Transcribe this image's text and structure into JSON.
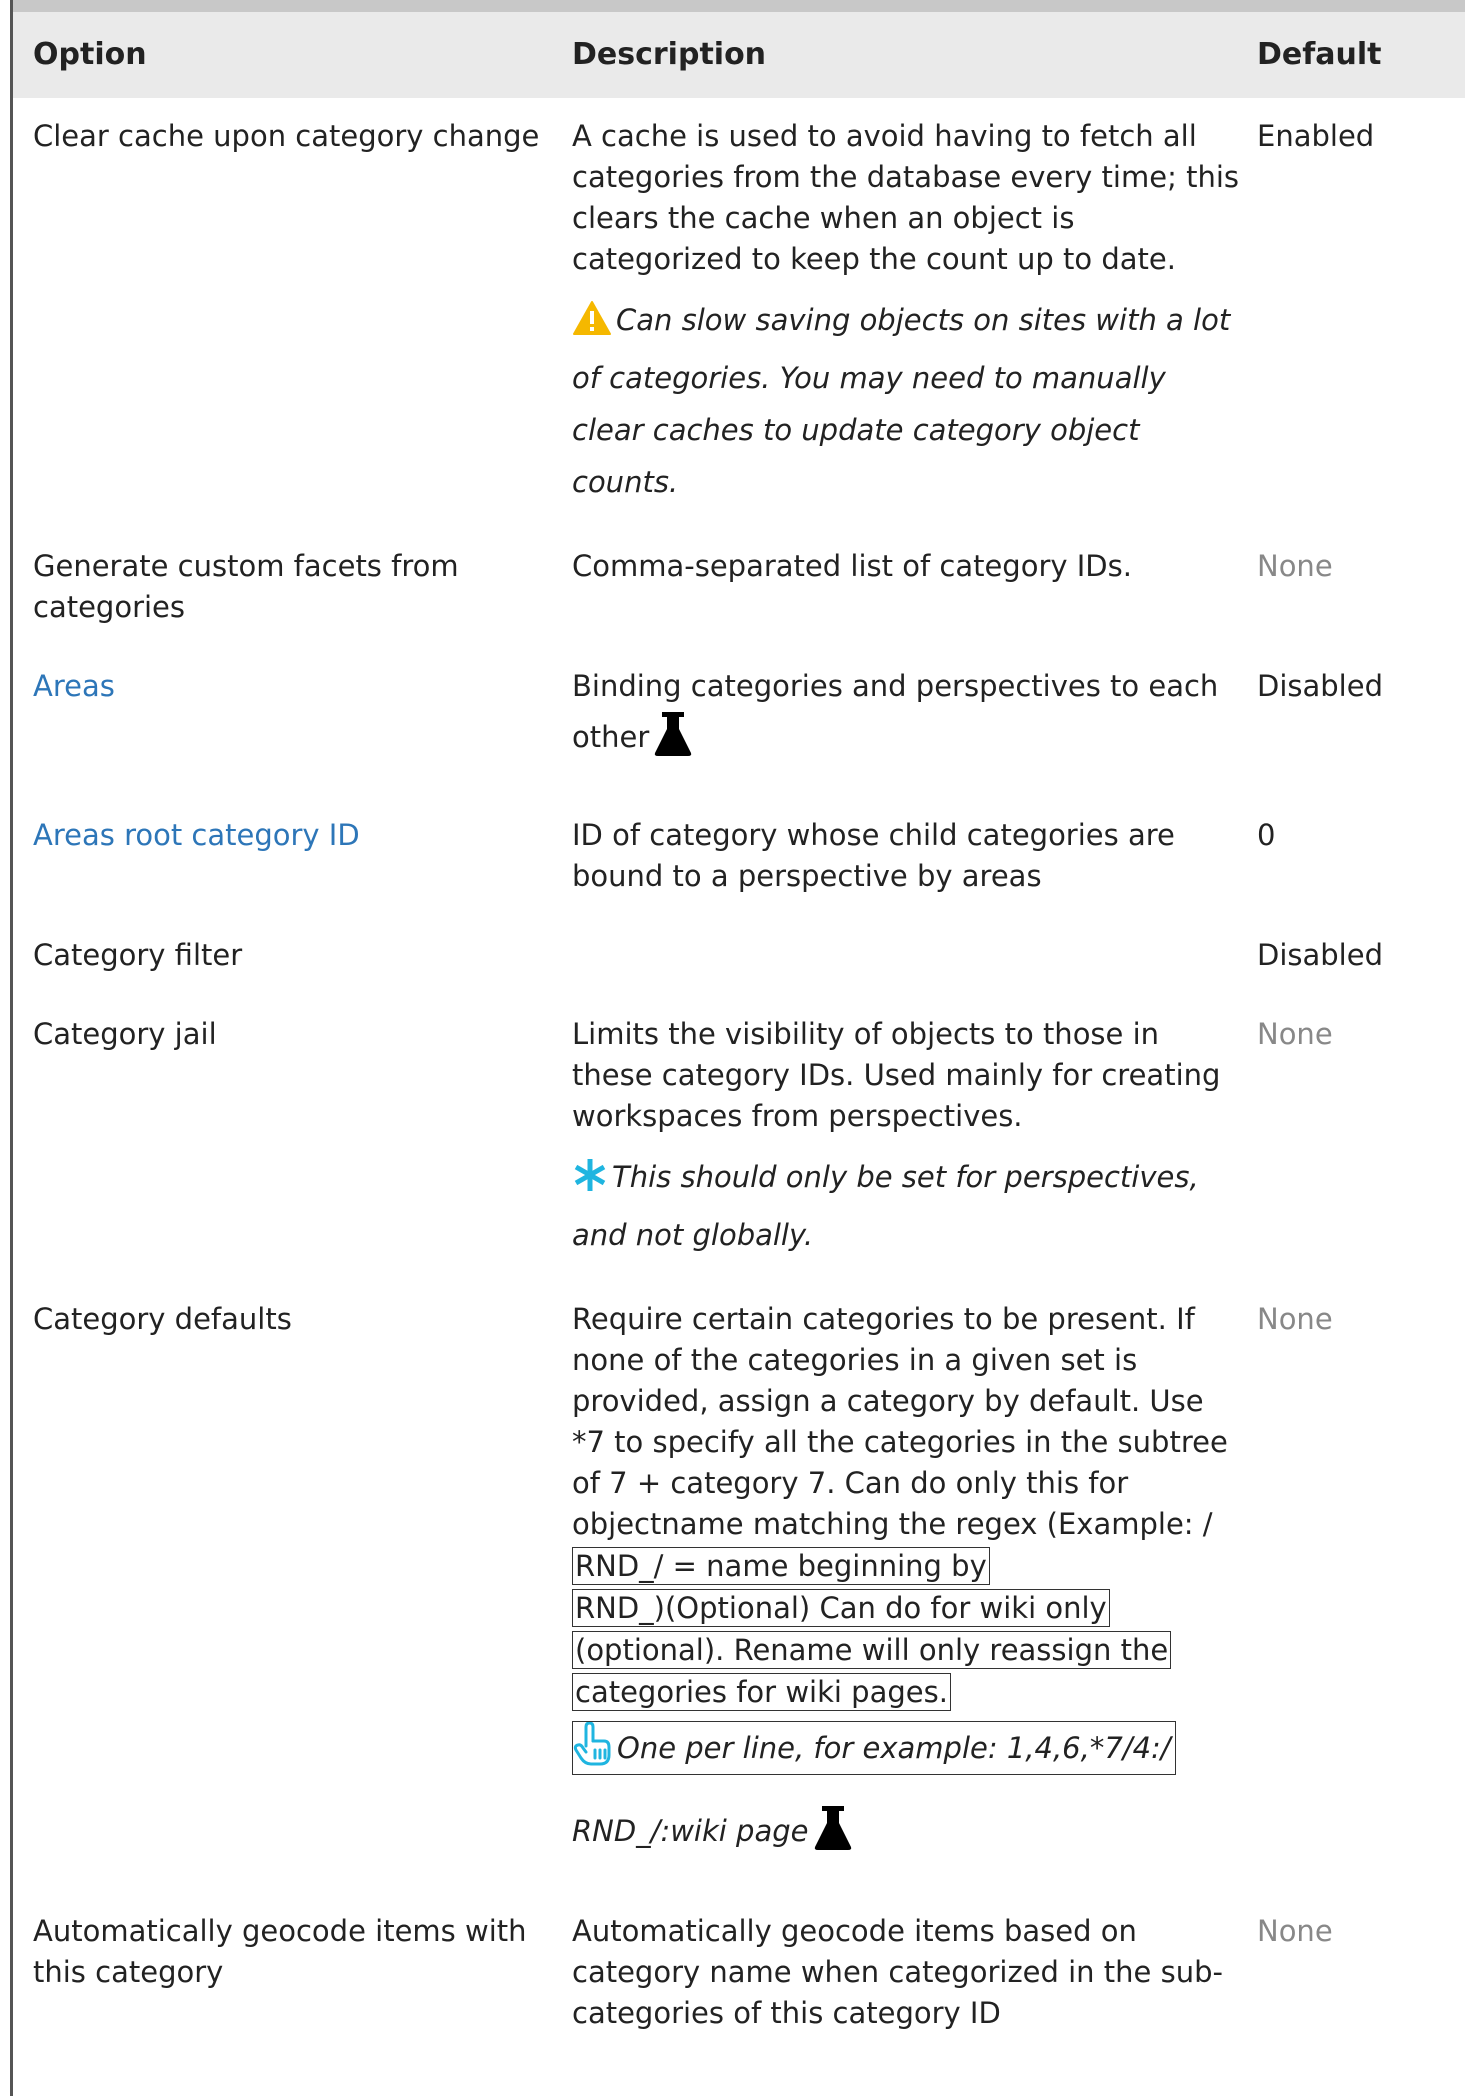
{
  "table": {
    "headers": [
      "Option",
      "Description",
      "Default"
    ],
    "rows": [
      {
        "option": "Clear cache upon category change",
        "description": "A cache is used to avoid having to fetch all categories from the database every time; this clears the cache when an object is categorized to keep the count up to date.",
        "warning": "Can slow saving objects on sites with a lot of categories. You may need to manually clear caches to update category object counts.",
        "default": "Enabled"
      },
      {
        "option": "Generate custom facets from categories",
        "description": "Comma-separated list of category IDs.",
        "default": "None"
      },
      {
        "option": "Areas",
        "description_part1": "Binding categories and perspectives to each",
        "description_part2": "other",
        "default": "Disabled"
      },
      {
        "option": "Areas root category ID",
        "description": "ID of category whose child categories are bound to a perspective by areas",
        "default": "0"
      },
      {
        "option": "Category filter",
        "description": "",
        "default": "Disabled"
      },
      {
        "option": "Category jail",
        "description": "Limits the visibility of objects to those in these category IDs. Used mainly for creating workspaces from perspectives.",
        "note": "This should only be set for perspectives, and not globally.",
        "default": "None"
      },
      {
        "option": "Category defaults",
        "description": "Require certain categories to be present. If none of the categories in a given set is provided, assign a category by default. Use *7 to specify all the categories in the subtree of 7 + category 7. Can do only this for objectname matching the regex (Example: /",
        "boxed_lines": [
          "RND_/ = name beginning by",
          "RND_)(Optional) Can do for wiki only",
          "(optional). Rename will only reassign the",
          "categories for wiki pages."
        ],
        "tip_line1": "One per line, for example: 1,4,6,*7/4:/",
        "tip_line2": "RND_/:wiki page",
        "default": "None"
      },
      {
        "option": "Automatically geocode items with this category",
        "description": "Automatically geocode items based on category name when categorized in the sub-categories of this category ID",
        "default": "None"
      }
    ]
  },
  "icons": {
    "warning": "warning-triangle-icon",
    "asterisk": "asterisk-icon",
    "flask": "flask-icon",
    "pointer": "pointing-hand-icon"
  },
  "colors": {
    "link": "#2d76b8",
    "muted": "#888888",
    "header_bg": "#eaeaea",
    "warning": "#f5b800",
    "asterisk": "#1fb5e0"
  }
}
